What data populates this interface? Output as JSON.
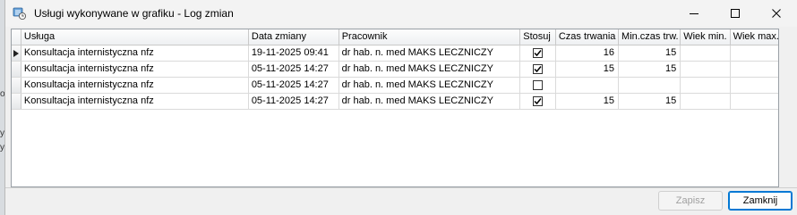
{
  "window": {
    "title": "Usługi wykonywane w grafiku - Log zmian",
    "icon": "app-icon"
  },
  "background_fragments": [
    "o",
    "y",
    "y"
  ],
  "grid": {
    "columns": [
      {
        "key": "usluga",
        "label": "Usługa"
      },
      {
        "key": "data",
        "label": "Data zmiany"
      },
      {
        "key": "pracownik",
        "label": "Pracownik"
      },
      {
        "key": "stosuj",
        "label": "Stosuj"
      },
      {
        "key": "czas",
        "label": "Czas trwania"
      },
      {
        "key": "min_czas",
        "label": "Min.czas trw."
      },
      {
        "key": "wiek_min",
        "label": "Wiek min."
      },
      {
        "key": "wiek_max",
        "label": "Wiek max."
      }
    ],
    "rows": [
      {
        "usluga": "Konsultacja internistyczna nfz",
        "data": "19-11-2025 09:41",
        "pracownik": "dr hab. n. med MAKS LECZNICZY",
        "stosuj": true,
        "czas": "16",
        "min_czas": "15",
        "wiek_min": "",
        "wiek_max": "",
        "current": true
      },
      {
        "usluga": "Konsultacja internistyczna nfz",
        "data": "05-11-2025 14:27",
        "pracownik": "dr hab. n. med MAKS LECZNICZY",
        "stosuj": true,
        "czas": "15",
        "min_czas": "15",
        "wiek_min": "",
        "wiek_max": "",
        "current": false
      },
      {
        "usluga": "Konsultacja internistyczna nfz",
        "data": "05-11-2025 14:27",
        "pracownik": "dr hab. n. med MAKS LECZNICZY",
        "stosuj": false,
        "czas": "",
        "min_czas": "",
        "wiek_min": "",
        "wiek_max": "",
        "current": false
      },
      {
        "usluga": "Konsultacja internistyczna nfz",
        "data": "05-11-2025 14:27",
        "pracownik": "dr hab. n. med MAKS LECZNICZY",
        "stosuj": true,
        "czas": "15",
        "min_czas": "15",
        "wiek_min": "",
        "wiek_max": "",
        "current": false
      }
    ]
  },
  "buttons": {
    "save_label": "Zapisz",
    "save_enabled": false,
    "close_label": "Zamknij"
  },
  "colors": {
    "accent": "#0078d4"
  }
}
